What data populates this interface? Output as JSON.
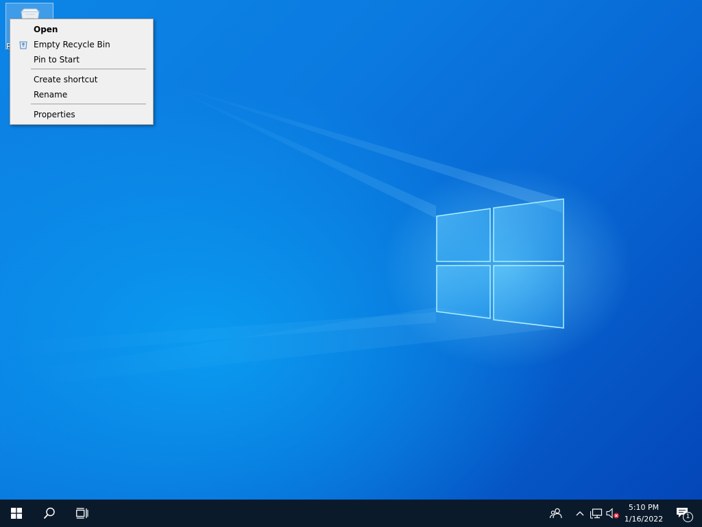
{
  "desktop": {
    "icon_label": "R",
    "icon_name": "recycle-bin-icon"
  },
  "context_menu": {
    "items": [
      {
        "label": "Open",
        "bold": true
      },
      {
        "label": "Empty Recycle Bin",
        "icon": "recycle-bin-small-icon"
      },
      {
        "label": "Pin to Start"
      },
      {
        "label": "Create shortcut"
      },
      {
        "label": "Rename"
      },
      {
        "label": "Properties"
      }
    ]
  },
  "taskbar": {
    "start_icon": "windows-start-icon",
    "search_icon": "search-icon",
    "task_view_icon": "task-view-icon",
    "people_icon": "people-icon",
    "chevron_icon": "show-hidden-icons-chevron",
    "network_icon": "network-icon",
    "volume_icon": "volume-muted-icon",
    "clock": {
      "time": "5:10 PM",
      "date": "1/16/2022"
    },
    "notifications": {
      "icon": "action-center-icon",
      "count": "1"
    }
  },
  "colors": {
    "taskbar_bg": "#0b1a2b",
    "menu_bg": "#f0f0f0",
    "desktop_accent": "#0b7ae0"
  }
}
